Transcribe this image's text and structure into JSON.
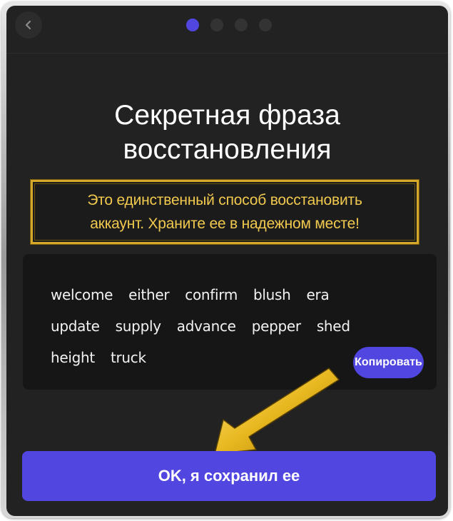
{
  "header": {
    "back_icon": "chevron-left-icon",
    "steps": [
      {
        "active": true
      },
      {
        "active": false
      },
      {
        "active": false
      },
      {
        "active": false
      }
    ]
  },
  "title_lines": [
    "Секретная фраза",
    "восстановления"
  ],
  "warning": {
    "lines": [
      "Это единственный способ восстановить",
      "аккаунт. Храните ее в надежном месте!"
    ],
    "color": "#f1c94e"
  },
  "phrase": {
    "words": [
      "welcome",
      "either",
      "confirm",
      "blush",
      "era",
      "update",
      "supply",
      "advance",
      "pepper",
      "shed",
      "height",
      "truck"
    ],
    "copy_label": "Копировать"
  },
  "confirm_button": {
    "label": "OK, я сохранил ее"
  },
  "annotation": {
    "icon": "arrow-pointer-icon",
    "color": "#e8b820"
  },
  "colors": {
    "accent": "#5146e0",
    "background": "#222223",
    "panel": "#161617"
  }
}
